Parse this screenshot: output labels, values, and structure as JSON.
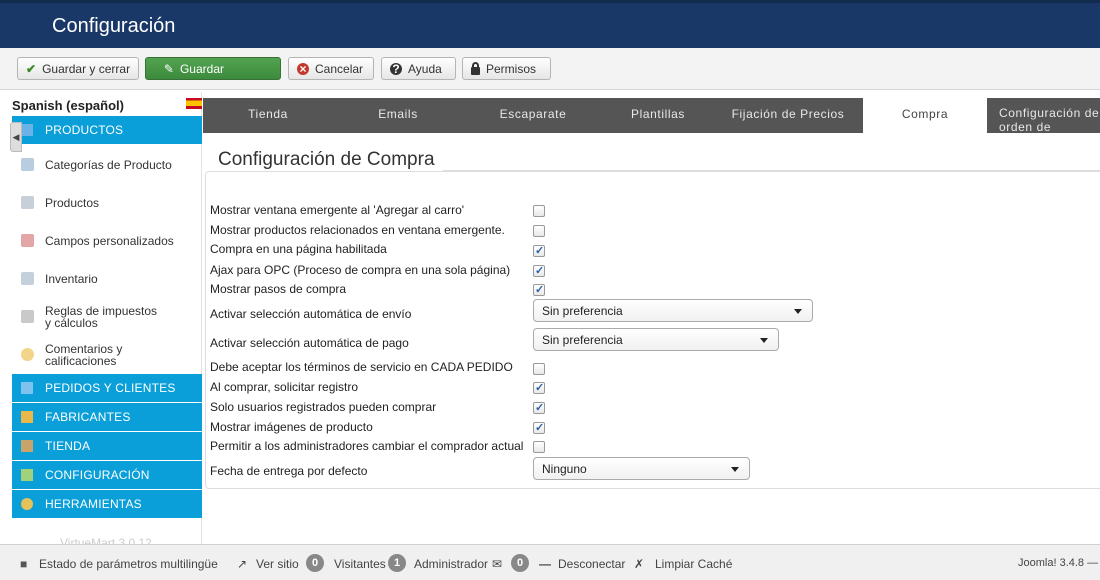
{
  "header": {
    "title": "Configuración"
  },
  "toolbar": {
    "save_close": "Guardar y cerrar",
    "save": "Guardar",
    "cancel": "Cancelar",
    "help": "Ayuda",
    "permissions": "Permisos"
  },
  "sidebar": {
    "language": "Spanish (español)",
    "sections": {
      "productos": "PRODUCTOS",
      "pedidos": "PEDIDOS Y CLIENTES",
      "fabricantes": "FABRICANTES",
      "tienda": "TIENDA",
      "configuracion": "CONFIGURACIÓN",
      "herramientas": "HERRAMIENTAS"
    },
    "items": [
      {
        "label": "Categorías de Producto",
        "icon": "folder-icon"
      },
      {
        "label": "Productos",
        "icon": "box-icon"
      },
      {
        "label": "Campos personalizados",
        "icon": "fields-icon"
      },
      {
        "label": "Inventario",
        "icon": "chart-icon"
      },
      {
        "label": "Reglas de impuestos y cálculos",
        "icon": "calculator-icon"
      },
      {
        "label": "Comentarios y calificaciones",
        "icon": "comment-icon"
      }
    ],
    "version": "VirtueMart 3.0.12"
  },
  "tabs": [
    {
      "label": "Tienda"
    },
    {
      "label": "Emails"
    },
    {
      "label": "Escaparate"
    },
    {
      "label": "Plantillas"
    },
    {
      "label": "Fijación de Precios"
    },
    {
      "label": "Compra"
    },
    {
      "label": "Configuración de orden de productos"
    }
  ],
  "section": {
    "legend": "Configuración de Compra",
    "rows": [
      {
        "label": "Mostrar ventana emergente al 'Agregar al carro'",
        "checked": false
      },
      {
        "label": "Mostrar productos relacionados en ventana emergente.",
        "checked": false
      },
      {
        "label": "Compra en una página habilitada",
        "checked": true
      },
      {
        "label": "Ajax para OPC (Proceso de compra en una sola página)",
        "checked": true
      },
      {
        "label": "Mostrar pasos de compra",
        "checked": true
      },
      {
        "label": "Activar selección automática de envío",
        "select": "Sin preferencia"
      },
      {
        "label": "Activar selección automática de pago",
        "select": "Sin preferencia"
      },
      {
        "label": "Debe aceptar los términos de servicio en CADA PEDIDO",
        "checked": false
      },
      {
        "label": "Al comprar, solicitar registro",
        "checked": true
      },
      {
        "label": "Solo usuarios registrados pueden comprar",
        "checked": true
      },
      {
        "label": "Mostrar imágenes de producto",
        "checked": true
      },
      {
        "label": "Permitir a los administradores cambiar el comprador actual",
        "checked": false
      },
      {
        "label": "Fecha de entrega por defecto",
        "select": "Ninguno"
      }
    ]
  },
  "status": {
    "multilang": "Estado de parámetros multilingüe",
    "view_site": "Ver sitio",
    "visitors_count": "0",
    "visitors": "Visitantes",
    "admin_count": "1",
    "admin": "Administrador",
    "messages_count": "0",
    "logout": "Desconectar",
    "clear_cache": "Limpiar Caché",
    "version": "Joomla! 3.4.8 —"
  }
}
